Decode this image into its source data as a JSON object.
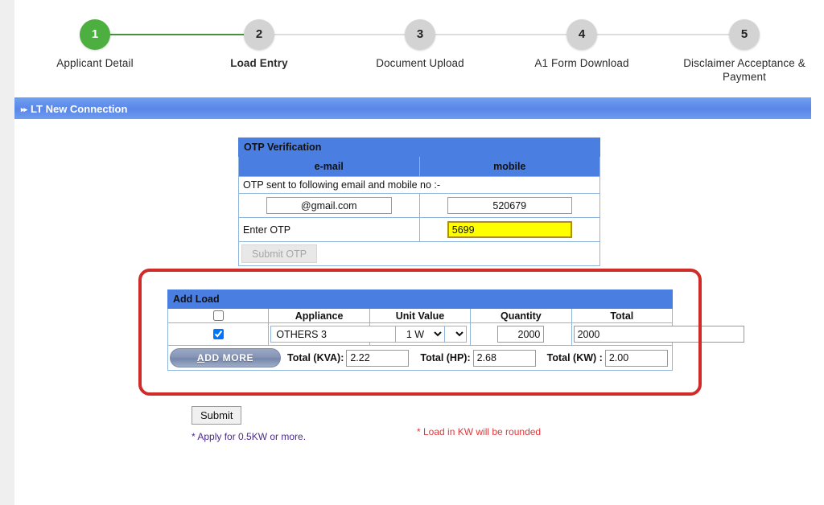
{
  "stepper": {
    "steps": [
      {
        "number": "1",
        "label": "Applicant Detail",
        "state": "done"
      },
      {
        "number": "2",
        "label": "Load Entry",
        "state": "current"
      },
      {
        "number": "3",
        "label": "Document Upload",
        "state": "pending"
      },
      {
        "number": "4",
        "label": "A1 Form Download",
        "state": "pending"
      },
      {
        "number": "5",
        "label": "Disclaimer Acceptance & Payment",
        "state": "pending"
      }
    ],
    "colors": {
      "done": "#4caf3f",
      "pending": "#d3d3d3",
      "connector_filled": "#4a9040",
      "connector_empty": "#dddddd"
    }
  },
  "section_bar": {
    "chevron": "▸▸",
    "title": "LT New Connection",
    "color": "#5b87e8"
  },
  "otp": {
    "title": "OTP Verification",
    "col_email": "e-mail",
    "col_mobile": "mobile",
    "note": "OTP sent to following email and mobile no :-",
    "email_value": "@gmail.com",
    "email_placeholder": "",
    "mobile_value": "520679",
    "mobile_placeholder": "",
    "enter_otp_label": "Enter OTP",
    "otp_value": "5699",
    "otp_placeholder": "",
    "otp_field_color": "#ffff00",
    "submit_label": "Submit OTP",
    "submit_disabled": true
  },
  "load": {
    "title": "Add Load",
    "columns": {
      "select": "",
      "appliance": "Appliance",
      "unit_value": "Unit Value",
      "quantity": "Quantity",
      "total": "Total"
    },
    "header_checked": false,
    "rows": [
      {
        "checked": true,
        "appliance": "OTHERS 3",
        "unit_value": "1 W",
        "quantity": "2000",
        "total": "2000"
      }
    ],
    "add_more_label": "ADD MORE",
    "add_more_accesskey": "A",
    "totals": [
      {
        "label": "Total (KVA):",
        "value": "2.22"
      },
      {
        "label": "Total (HP):",
        "value": "2.68"
      },
      {
        "label": "Total (KW) :",
        "value": "2.00"
      }
    ]
  },
  "footer": {
    "submit_label": "Submit",
    "note_left": "* Apply for 0.5KW or more.",
    "note_left_color": "#4b2b8c",
    "note_right": "* Load in KW will be rounded",
    "note_right_color": "#e0383a"
  },
  "annotation": {
    "shape": "rounded-rectangle",
    "color": "#cf2b29"
  }
}
